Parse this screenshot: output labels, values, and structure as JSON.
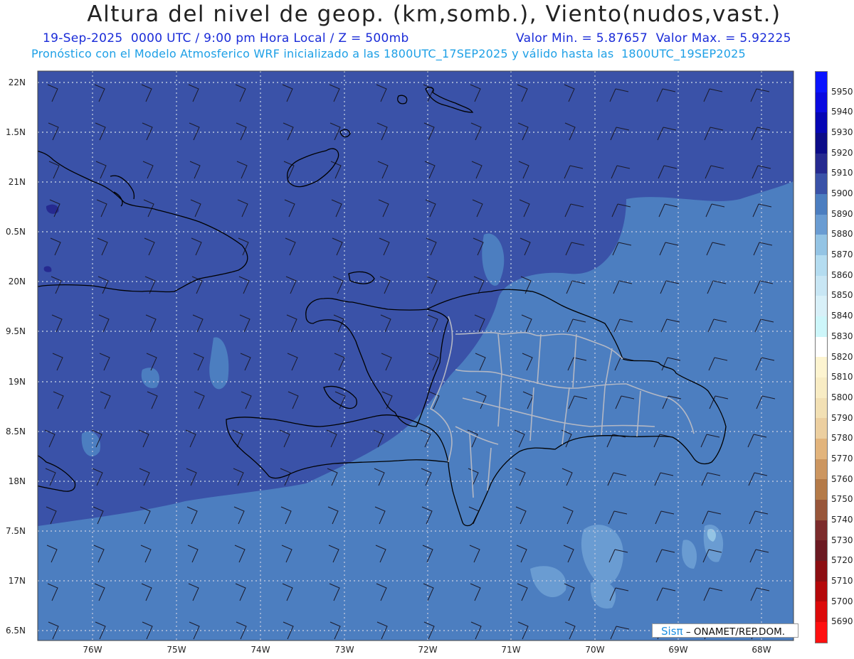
{
  "header": {
    "title": "Altura del nivel de geop. (km,somb.), Viento(nudos,vast.)",
    "line1_left": "19-Sep-2025  0000 UTC / 9:00 pm Hora Local / Z = 500mb",
    "line1_right": "Valor Min. = 5.87657  Valor Max. = 5.92225",
    "line2": "Pronóstico con el Modelo Atmosferico WRF inicializado a las 1800UTC_17SEP2025 y válido hasta las  1800UTC_19SEP2025"
  },
  "axes": {
    "lat_labels": [
      "22N",
      "1.5N",
      "21N",
      "0.5N",
      "20N",
      "9.5N",
      "19N",
      "8.5N",
      "18N",
      "7.5N",
      "17N",
      "6.5N"
    ],
    "lon_labels": [
      "76W",
      "75W",
      "74W",
      "73W",
      "72W",
      "71W",
      "70W",
      "69W",
      "68W"
    ]
  },
  "colorbar": {
    "levels": [
      "5950",
      "5940",
      "5930",
      "5920",
      "5910",
      "5900",
      "5890",
      "5880",
      "5870",
      "5860",
      "5850",
      "5840",
      "5830",
      "5820",
      "5810",
      "5800",
      "5790",
      "5780",
      "5770",
      "5760",
      "5750",
      "5740",
      "5730",
      "5720",
      "5710",
      "5700",
      "5690"
    ],
    "colors": [
      "#0a14ff",
      "#0a0ae0",
      "#0606b4",
      "#0c0c88",
      "#262a90",
      "#3a52a8",
      "#4c7ec0",
      "#6a9cd2",
      "#94c4e4",
      "#b4dcf0",
      "#c8e6f4",
      "#d8f0f8",
      "#cdf6fa",
      "#ffffff",
      "#fdf4d0",
      "#f8ecc4",
      "#f2e0b4",
      "#eccfa0",
      "#e2b47c",
      "#cc9660",
      "#b47a48",
      "#98563a",
      "#7c2c2c",
      "#6c1a22",
      "#8c0e12",
      "#b4080a",
      "#dc0a0a",
      "#ff1010"
    ],
    "color_notes": {
      "background_5900": "#3a52a8",
      "mid_5890": "#4c7ec0",
      "light_5880": "#6a9cd2",
      "high_5910": "#262a90"
    }
  },
  "credit": {
    "brand": "Sisπ",
    "text": "– ONAMET/REP.DOM."
  }
}
